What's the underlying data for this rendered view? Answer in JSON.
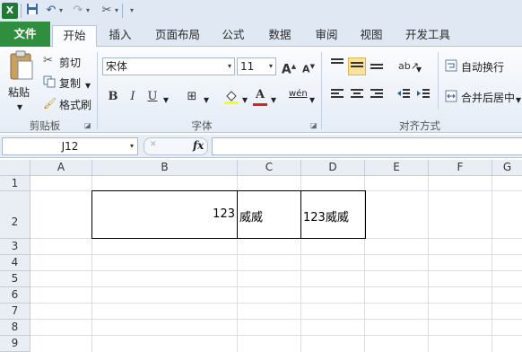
{
  "quick_access": {
    "icons": [
      "excel-logo-icon",
      "save-icon",
      "undo-icon",
      "redo-icon",
      "tools-icon",
      "customize-icon"
    ]
  },
  "tabs": [
    {
      "label": "文件"
    },
    {
      "label": "开始"
    },
    {
      "label": "插入"
    },
    {
      "label": "页面布局"
    },
    {
      "label": "公式"
    },
    {
      "label": "数据"
    },
    {
      "label": "审阅"
    },
    {
      "label": "视图"
    },
    {
      "label": "开发工具"
    }
  ],
  "ribbon": {
    "clipboard": {
      "paste": "粘贴",
      "cut": "剪切",
      "copy": "复制",
      "format_painter": "格式刷",
      "group": "剪贴板"
    },
    "font": {
      "name": "宋体",
      "size": "11",
      "bold": "B",
      "italic": "I",
      "underline": "U",
      "font_color_glyph": "A",
      "grow": "A",
      "shrink": "A",
      "wen": "wén",
      "group": "字体"
    },
    "alignment": {
      "wrap_text": "自动换行",
      "merge_center": "合并后居中",
      "group": "对齐方式"
    }
  },
  "formula_bar": {
    "name_box": "J12",
    "fx": "fx",
    "value": ""
  },
  "sheet": {
    "columns": [
      "A",
      "B",
      "C",
      "D",
      "E",
      "F",
      "G"
    ],
    "rows": [
      "1",
      "2",
      "3",
      "4",
      "5",
      "6",
      "7",
      "8",
      "9"
    ],
    "cells": {
      "B2": "123",
      "C2": "威威",
      "D2": "123威威"
    }
  }
}
